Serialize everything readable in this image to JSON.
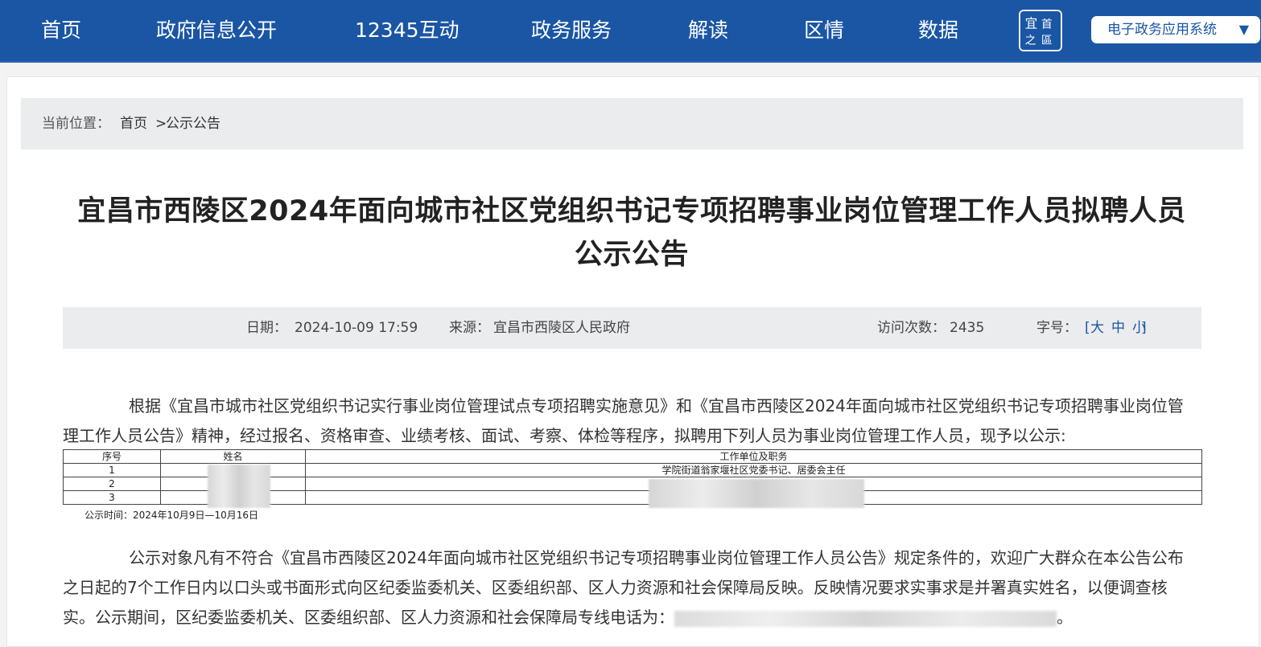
{
  "nav": {
    "items": [
      "首页",
      "政府信息公开",
      "12345互动",
      "政务服务",
      "解读",
      "区情",
      "数据"
    ],
    "logo_text": "宜昌之首区",
    "system_select": "电子政务应用系统",
    "system_select_arrow": "▼"
  },
  "breadcrumb": {
    "prefix": "当前位置：",
    "home": "首页",
    "sep": ">",
    "current": "公示公告"
  },
  "article": {
    "title_line1": "宜昌市西陵区2024年面向城市社区党组织书记专项招聘事业岗位管理工作人员拟聘人员",
    "title_line2": "公示公告",
    "meta": {
      "date_label": "日期：",
      "date": "2024-10-09 17:59",
      "source_label": "来源：",
      "source": "宜昌市西陵区人民政府",
      "visits_label": "访问次数：",
      "visits": "2435",
      "fontsize_label": "字号：",
      "bracket_open": "[",
      "large": "大",
      "medium": "中",
      "small": "小",
      "bracket_close": "]"
    },
    "intro": "根据《宜昌市城市社区党组织书记实行事业岗位管理试点专项招聘实施意见》和《宜昌市西陵区2024年面向城市社区党组织书记专项招聘事业岗位管理工作人员公告》精神，经过报名、资格审查、业绩考核、面试、考察、体检等程序，拟聘用下列人员为事业岗位管理工作人员，现予以公示:",
    "table": {
      "headers": [
        "序号",
        "姓名",
        "工作单位及职务"
      ],
      "rows": [
        [
          "1",
          "龚",
          "学院街道翁家堰社区党委书记、居委会主任"
        ],
        [
          "2",
          "",
          ""
        ],
        [
          "3",
          "",
          ""
        ]
      ]
    },
    "publicity_time": "公示时间：2024年10月9日—10月16日",
    "notice": "公示对象凡有不符合《宜昌市西陵区2024年面向城市社区党组织书记专项招聘事业岗位管理工作人员公告》规定条件的，欢迎广大群众在本公告公布之日起的7个工作日内以口头或书面形式向区纪委监委机关、区委组织部、区人力资源和社会保障局反映。反映情况要求实事求是并署真实姓名，以便调查核实。公示期间，区纪委监委机关、区委组织部、区人力资源和社会保障局专线电话为：",
    "notice_end": "。"
  }
}
